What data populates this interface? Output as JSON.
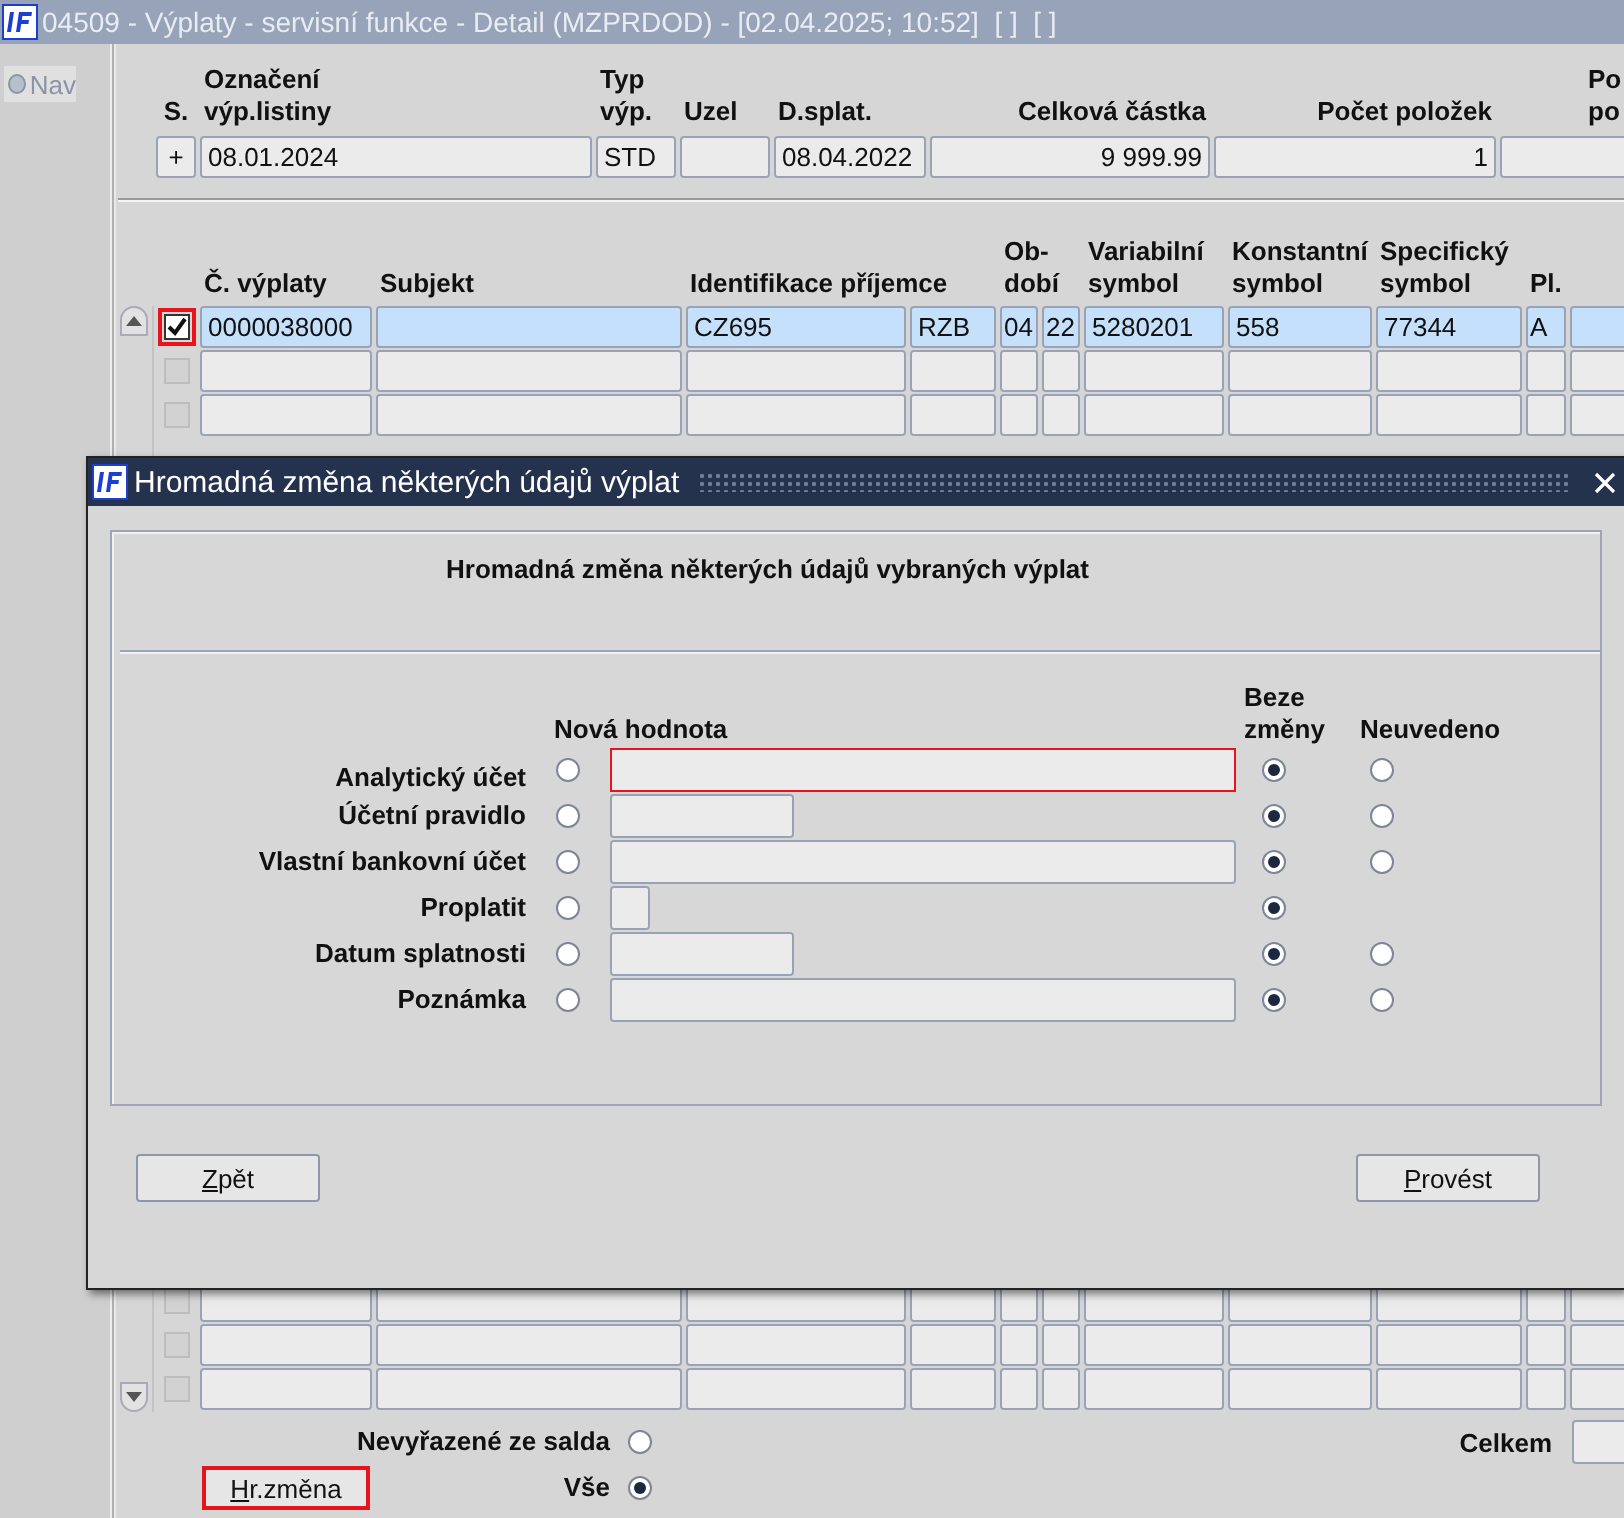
{
  "window": {
    "title": "04509 - Výplaty - servisní funkce - Detail (MZPRDOD) - [02.04.2025; 10:52]  [ ]  [ ]"
  },
  "sidebar": {
    "items": [
      {
        "label": "Nav"
      }
    ]
  },
  "header_table": {
    "columns": [
      {
        "lines": [
          "S."
        ],
        "kind": "mark"
      },
      {
        "lines": [
          "Označení",
          "výp.listiny"
        ],
        "kind": "text"
      },
      {
        "lines": [
          "Typ",
          "výp."
        ],
        "kind": "text"
      },
      {
        "lines": [
          "Uzel"
        ],
        "kind": "text"
      },
      {
        "lines": [
          "D.splat."
        ],
        "kind": "text"
      },
      {
        "lines": [
          "Celková částka"
        ],
        "kind": "number"
      },
      {
        "lines": [
          "Počet položek"
        ],
        "kind": "number"
      },
      {
        "lines": [
          "Po",
          "po"
        ],
        "kind": "text"
      }
    ],
    "rows": [
      {
        "cells": [
          "+",
          "08.01.2024",
          "STD",
          null,
          "08.04.2022",
          "9 999.99",
          "1",
          null
        ]
      }
    ]
  },
  "detail_table": {
    "columns": [
      {
        "lines": [
          "Č. výplaty"
        ]
      },
      {
        "lines": [
          "Subjekt"
        ]
      },
      {
        "lines": [
          "Identifikace příjemce"
        ]
      },
      {},
      {
        "lines": [
          "Ob-",
          "dobí"
        ]
      },
      {},
      {
        "lines": [
          "Variabilní",
          "symbol"
        ]
      },
      {
        "lines": [
          "Konstantní",
          "symbol"
        ]
      },
      {
        "lines": [
          "Specifický",
          "symbol"
        ]
      },
      {
        "lines": [
          "Pl."
        ]
      },
      {}
    ],
    "rows": [
      {
        "checked": true,
        "selected": true,
        "highlighted": true,
        "cells": [
          "0000038000",
          null,
          "CZ695",
          "RZB",
          "04",
          "22",
          "5280201",
          "558",
          "77344",
          "A",
          null
        ]
      },
      {
        "checked": false,
        "selected": false,
        "highlighted": false
      },
      {
        "checked": false,
        "selected": false,
        "highlighted": false
      },
      {
        "checked": false,
        "selected": false,
        "highlighted": false
      },
      {
        "checked": false,
        "selected": false,
        "highlighted": false
      },
      {
        "checked": false,
        "selected": false,
        "highlighted": false
      }
    ]
  },
  "filter_options": [
    {
      "label": "Nevyřazené ze salda",
      "selected": false
    },
    {
      "label": "Vše",
      "selected": true
    }
  ],
  "mass_change_button": {
    "label": "Hr.změna",
    "highlighted": true
  },
  "total": {
    "label": "Celkem"
  },
  "dialog": {
    "title": "Hromadná změna některých údajů výplat",
    "heading": "Hromadná změna některých údajů vybraných výplat",
    "column_headers": {
      "new_value": [
        "Nová hodnota"
      ],
      "unchanged": [
        "Beze",
        "změny"
      ],
      "not_specified": [
        "Neuvedeno"
      ]
    },
    "rows": [
      {
        "label": "Analytický účet",
        "field": {
          "kind": "text",
          "highlighted": true
        },
        "options": [
          {
            "kind": "new_value",
            "selected": false
          },
          {
            "kind": "unchanged",
            "selected": true
          },
          {
            "kind": "not_specified",
            "selected": false
          }
        ]
      },
      {
        "label": "Účetní pravidlo",
        "field": {
          "kind": "code",
          "highlighted": false
        },
        "options": [
          {
            "kind": "new_value",
            "selected": false
          },
          {
            "kind": "unchanged",
            "selected": true
          },
          {
            "kind": "not_specified",
            "selected": false
          }
        ]
      },
      {
        "label": "Vlastní bankovní účet",
        "field": {
          "kind": "text",
          "highlighted": false
        },
        "options": [
          {
            "kind": "new_value",
            "selected": false
          },
          {
            "kind": "unchanged",
            "selected": true
          },
          {
            "kind": "not_specified",
            "selected": false
          }
        ]
      },
      {
        "label": "Proplatit",
        "field": {
          "kind": "flag",
          "highlighted": false
        },
        "options": [
          {
            "kind": "new_value",
            "selected": false
          },
          {
            "kind": "unchanged",
            "selected": true
          }
        ]
      },
      {
        "label": "Datum splatnosti",
        "field": {
          "kind": "date",
          "highlighted": false
        },
        "options": [
          {
            "kind": "new_value",
            "selected": false
          },
          {
            "kind": "unchanged",
            "selected": true
          },
          {
            "kind": "not_specified",
            "selected": false
          }
        ]
      },
      {
        "label": "Poznámka",
        "field": {
          "kind": "text",
          "highlighted": false
        },
        "options": [
          {
            "kind": "new_value",
            "selected": false
          },
          {
            "kind": "unchanged",
            "selected": true
          },
          {
            "kind": "not_specified",
            "selected": false
          }
        ]
      }
    ],
    "buttons": [
      {
        "label": "Zpět"
      },
      {
        "label": "Provést"
      }
    ]
  }
}
